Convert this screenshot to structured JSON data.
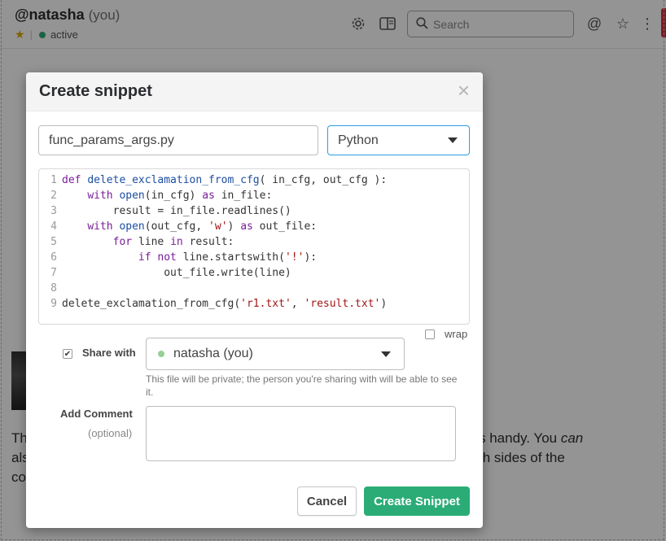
{
  "header": {
    "channel_name": "@natasha",
    "channel_suffix": "(you)",
    "status": "active",
    "search_placeholder": "Search"
  },
  "background": {
    "message_lines": [
      {
        "left": "Th",
        "right": "s handy. You ",
        "right_em": "can"
      },
      {
        "left": "als",
        "right": "th sides of the"
      },
      {
        "left": "co",
        "right": ""
      }
    ]
  },
  "modal": {
    "title": "Create snippet",
    "close_glyph": "×",
    "filename": "func_params_args.py",
    "language": "Python",
    "code_lines": [
      {
        "num": "1",
        "tokens": [
          {
            "t": "def ",
            "c": "kw"
          },
          {
            "t": "delete_exclamation_from_cfg",
            "c": "fn"
          },
          {
            "t": "( in_cfg, out_cfg ):",
            "c": ""
          }
        ]
      },
      {
        "num": "2",
        "tokens": [
          {
            "t": "    ",
            "c": ""
          },
          {
            "t": "with ",
            "c": "kw"
          },
          {
            "t": "open",
            "c": "fn"
          },
          {
            "t": "(in_cfg) ",
            "c": ""
          },
          {
            "t": "as ",
            "c": "kw"
          },
          {
            "t": "in_file:",
            "c": ""
          }
        ]
      },
      {
        "num": "3",
        "tokens": [
          {
            "t": "        result = in_file.readlines()",
            "c": ""
          }
        ]
      },
      {
        "num": "4",
        "tokens": [
          {
            "t": "    ",
            "c": ""
          },
          {
            "t": "with ",
            "c": "kw"
          },
          {
            "t": "open",
            "c": "fn"
          },
          {
            "t": "(out_cfg, ",
            "c": ""
          },
          {
            "t": "'w'",
            "c": "str"
          },
          {
            "t": ") ",
            "c": ""
          },
          {
            "t": "as ",
            "c": "kw"
          },
          {
            "t": "out_file:",
            "c": ""
          }
        ]
      },
      {
        "num": "5",
        "tokens": [
          {
            "t": "        ",
            "c": ""
          },
          {
            "t": "for ",
            "c": "kw"
          },
          {
            "t": "line ",
            "c": ""
          },
          {
            "t": "in ",
            "c": "kw"
          },
          {
            "t": "result:",
            "c": ""
          }
        ]
      },
      {
        "num": "6",
        "tokens": [
          {
            "t": "            ",
            "c": ""
          },
          {
            "t": "if not ",
            "c": "kw"
          },
          {
            "t": "line.startswith(",
            "c": ""
          },
          {
            "t": "'!'",
            "c": "str"
          },
          {
            "t": "):",
            "c": ""
          }
        ]
      },
      {
        "num": "7",
        "tokens": [
          {
            "t": "                out_file.write(line)",
            "c": ""
          }
        ]
      },
      {
        "num": "8",
        "tokens": []
      },
      {
        "num": "9",
        "tokens": [
          {
            "t": "delete_exclamation_from_cfg(",
            "c": ""
          },
          {
            "t": "'r1.txt'",
            "c": "str"
          },
          {
            "t": ", ",
            "c": ""
          },
          {
            "t": "'result.txt'",
            "c": "str"
          },
          {
            "t": ")",
            "c": ""
          }
        ]
      }
    ],
    "wrap_label": "wrap",
    "wrap_checked": false,
    "share_label": "Share with",
    "share_checked": true,
    "share_with": "natasha (you)",
    "share_note": "This file will be private; the person you're sharing with will be able to see it.",
    "comment_label": "Add Comment",
    "comment_optional": "(optional)",
    "comment_value": "",
    "cancel_label": "Cancel",
    "create_label": "Create Snippet"
  },
  "colors": {
    "accent_green": "#2bac76",
    "select_focus": "#2d9ee0",
    "keyword": "#7a1e99",
    "function": "#1d4ea1",
    "string": "#a31515"
  }
}
